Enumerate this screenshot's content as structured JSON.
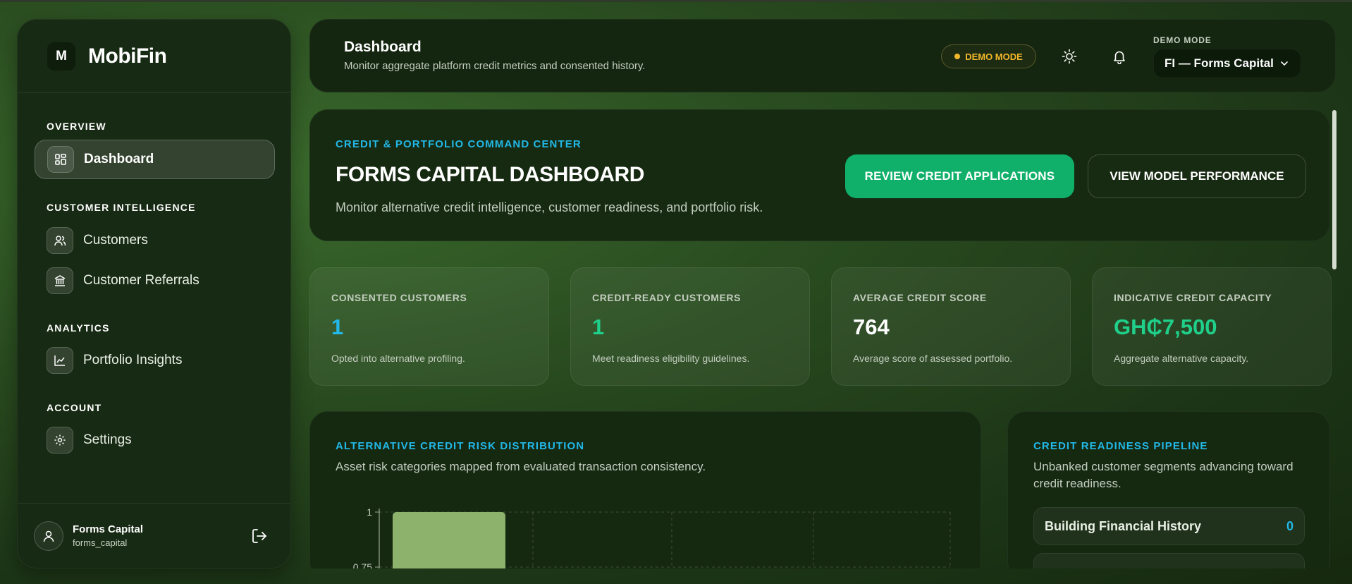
{
  "brand": {
    "logo_letter": "M",
    "name": "MobiFin"
  },
  "sidebar": {
    "sections": [
      {
        "title": "OVERVIEW",
        "items": [
          {
            "label": "Dashboard",
            "icon": "dashboard-grid-icon",
            "active": true
          }
        ]
      },
      {
        "title": "CUSTOMER INTELLIGENCE",
        "items": [
          {
            "label": "Customers",
            "icon": "users-icon"
          },
          {
            "label": "Customer Referrals",
            "icon": "bank-icon"
          }
        ]
      },
      {
        "title": "ANALYTICS",
        "items": [
          {
            "label": "Portfolio Insights",
            "icon": "line-chart-icon"
          }
        ]
      },
      {
        "title": "ACCOUNT",
        "items": [
          {
            "label": "Settings",
            "icon": "gear-icon"
          }
        ]
      }
    ],
    "user": {
      "name": "Forms Capital",
      "handle": "forms_capital"
    }
  },
  "header": {
    "title": "Dashboard",
    "subtitle": "Monitor aggregate platform credit metrics and consented history.",
    "demo_badge": "DEMO MODE",
    "mode_label": "DEMO MODE",
    "mode_value": "FI — Forms Capital"
  },
  "hero": {
    "eyebrow": "CREDIT & PORTFOLIO COMMAND CENTER",
    "title": "FORMS CAPITAL DASHBOARD",
    "subtitle": "Monitor alternative credit intelligence, customer readiness, and portfolio risk.",
    "primary_button": "REVIEW CREDIT APPLICATIONS",
    "secondary_button": "VIEW MODEL PERFORMANCE"
  },
  "stats": [
    {
      "label": "CONSENTED CUSTOMERS",
      "value": "1",
      "desc": "Opted into alternative profiling.",
      "color": "#22b8e8"
    },
    {
      "label": "CREDIT-READY CUSTOMERS",
      "value": "1",
      "desc": "Meet readiness eligibility guidelines.",
      "color": "#1fcf8a"
    },
    {
      "label": "AVERAGE CREDIT SCORE",
      "value": "764",
      "desc": "Average score of assessed portfolio.",
      "color": "#ffffff"
    },
    {
      "label": "INDICATIVE CREDIT CAPACITY",
      "value": "GH₵7,500",
      "desc": "Aggregate alternative capacity.",
      "color": "#1fcf8a"
    }
  ],
  "risk_panel": {
    "eyebrow": "ALTERNATIVE CREDIT RISK DISTRIBUTION",
    "subtitle": "Asset risk categories mapped from evaluated transaction consistency."
  },
  "pipeline_panel": {
    "eyebrow": "CREDIT READINESS PIPELINE",
    "subtitle_line1": "Unbanked customer segments advancing toward",
    "subtitle_line2": "credit readiness.",
    "rows": [
      {
        "label": "Building Financial History",
        "count": "0"
      }
    ]
  },
  "chart_data": {
    "type": "bar",
    "tick_labels": [
      "1",
      "0.75"
    ],
    "ylim": [
      0,
      1
    ],
    "values": [
      1
    ],
    "bar_color": "#8cb26c",
    "grid": true
  }
}
